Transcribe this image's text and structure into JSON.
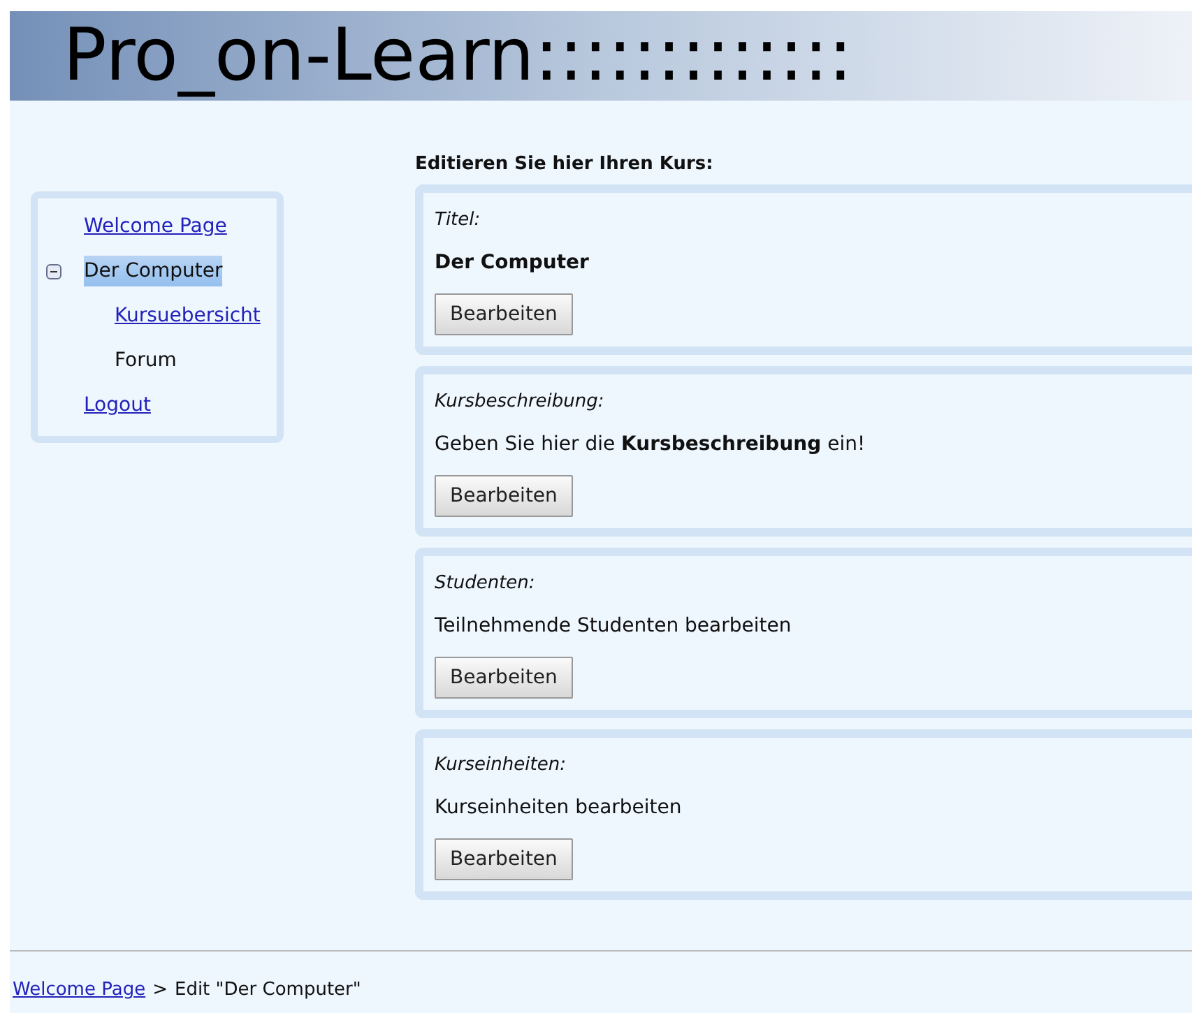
{
  "header": {
    "title": "Pro_on-Learn:::::::::::::"
  },
  "sidebar": {
    "items": [
      {
        "label": "Welcome Page",
        "link": true,
        "selected": false
      },
      {
        "label": "Der Computer",
        "link": false,
        "selected": true,
        "expanded": true,
        "children": [
          {
            "label": "Kursuebersicht",
            "link": true,
            "selected": false
          },
          {
            "label": "Forum",
            "link": false,
            "selected": false
          }
        ]
      },
      {
        "label": "Logout",
        "link": true,
        "selected": false
      }
    ]
  },
  "main": {
    "heading": "Editieren Sie hier Ihren Kurs:",
    "sections": [
      {
        "label": "Titel:",
        "value": "Der Computer",
        "value_bold": true,
        "button": "Bearbeiten"
      },
      {
        "label": "Kursbeschreibung:",
        "value": "Geben Sie hier die **Kursbeschreibung** ein!",
        "value_bold": false,
        "button": "Bearbeiten"
      },
      {
        "label": "Studenten:",
        "value": "Teilnehmende Studenten bearbeiten",
        "value_bold": false,
        "button": "Bearbeiten"
      },
      {
        "label": "Kurseinheiten:",
        "value": "Kurseinheiten bearbeiten",
        "value_bold": false,
        "button": "Bearbeiten"
      }
    ]
  },
  "breadcrumb": {
    "link": "Welcome Page",
    "separator": ">",
    "current": "Edit \"Der Computer\""
  }
}
